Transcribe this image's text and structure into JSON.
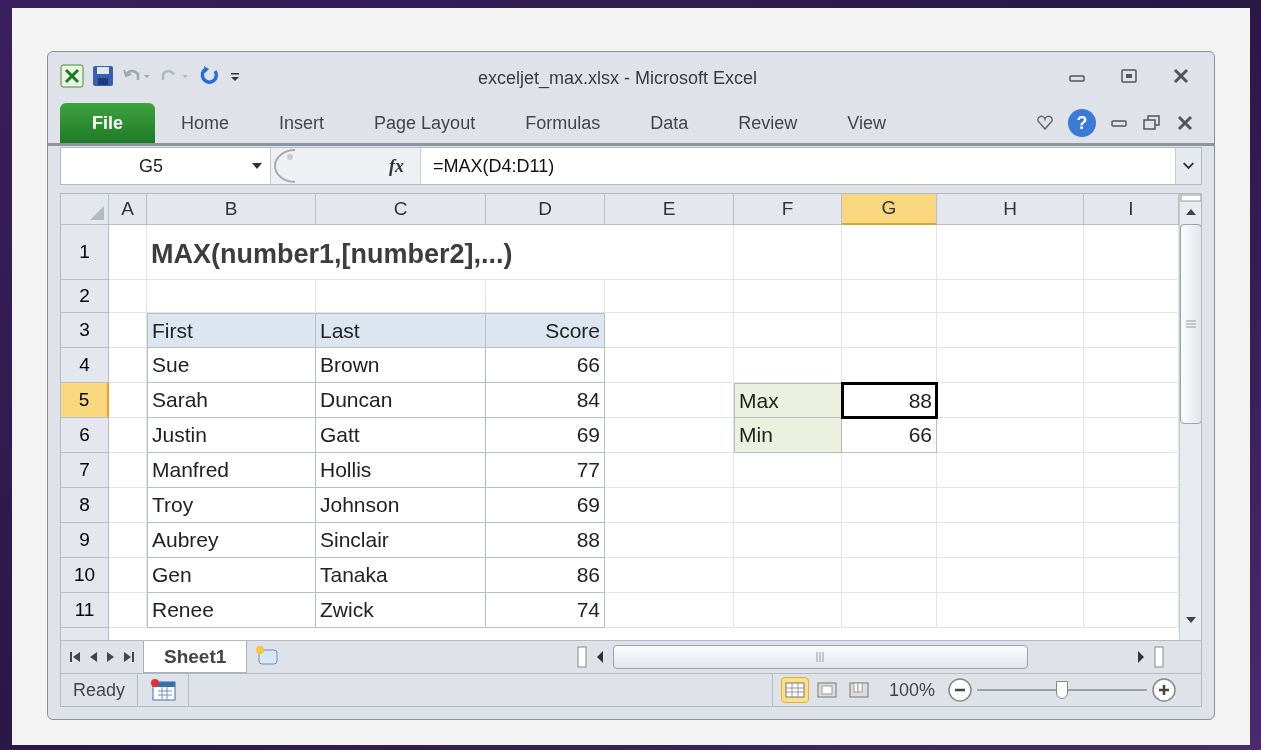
{
  "window": {
    "title": "exceljet_max.xlsx - Microsoft Excel"
  },
  "ribbon_tabs": [
    {
      "label": "File",
      "kind": "file"
    },
    {
      "label": "Home",
      "kind": "tab"
    },
    {
      "label": "Insert",
      "kind": "tab"
    },
    {
      "label": "Page Layout",
      "kind": "tab"
    },
    {
      "label": "Formulas",
      "kind": "tab"
    },
    {
      "label": "Data",
      "kind": "tab"
    },
    {
      "label": "Review",
      "kind": "tab"
    },
    {
      "label": "View",
      "kind": "tab"
    }
  ],
  "help_button": "?",
  "formula_bar": {
    "name_box": "G5",
    "fx": "fx",
    "formula": "=MAX(D4:D11)"
  },
  "columns": [
    {
      "label": "A",
      "selected": false
    },
    {
      "label": "B",
      "selected": false
    },
    {
      "label": "C",
      "selected": false
    },
    {
      "label": "D",
      "selected": false
    },
    {
      "label": "E",
      "selected": false
    },
    {
      "label": "F",
      "selected": false
    },
    {
      "label": "G",
      "selected": true
    },
    {
      "label": "H",
      "selected": false
    },
    {
      "label": "I",
      "selected": false
    }
  ],
  "rows": [
    {
      "label": "1",
      "selected": false
    },
    {
      "label": "2",
      "selected": false
    },
    {
      "label": "3",
      "selected": false
    },
    {
      "label": "4",
      "selected": false
    },
    {
      "label": "5",
      "selected": true
    },
    {
      "label": "6",
      "selected": false
    },
    {
      "label": "7",
      "selected": false
    },
    {
      "label": "8",
      "selected": false
    },
    {
      "label": "9",
      "selected": false
    },
    {
      "label": "10",
      "selected": false
    },
    {
      "label": "11",
      "selected": false
    }
  ],
  "sheet_title": "MAX(number1,[number2],...)",
  "table": {
    "columns": [
      "First",
      "Last",
      "Score"
    ],
    "rows": [
      [
        "Sue",
        "Brown",
        "66"
      ],
      [
        "Sarah",
        "Duncan",
        "84"
      ],
      [
        "Justin",
        "Gatt",
        "69"
      ],
      [
        "Manfred",
        "Hollis",
        "77"
      ],
      [
        "Troy",
        "Johnson",
        "69"
      ],
      [
        "Aubrey",
        "Sinclair",
        "88"
      ],
      [
        "Gen",
        "Tanaka",
        "86"
      ],
      [
        "Renee",
        "Zwick",
        "74"
      ]
    ]
  },
  "summary": [
    {
      "label": "Max",
      "value": "88",
      "selected": true
    },
    {
      "label": "Min",
      "value": "66",
      "selected": false
    }
  ],
  "sheet_tabs": [
    {
      "label": "Sheet1",
      "selected": true
    }
  ],
  "status_bar": {
    "status": "Ready",
    "views": [
      {
        "kind": "normal",
        "selected": true
      },
      {
        "kind": "page-layout",
        "selected": false
      },
      {
        "kind": "page-break",
        "selected": false
      }
    ],
    "zoom": "100%",
    "zoom_slider": {
      "level": 0.5
    }
  }
}
